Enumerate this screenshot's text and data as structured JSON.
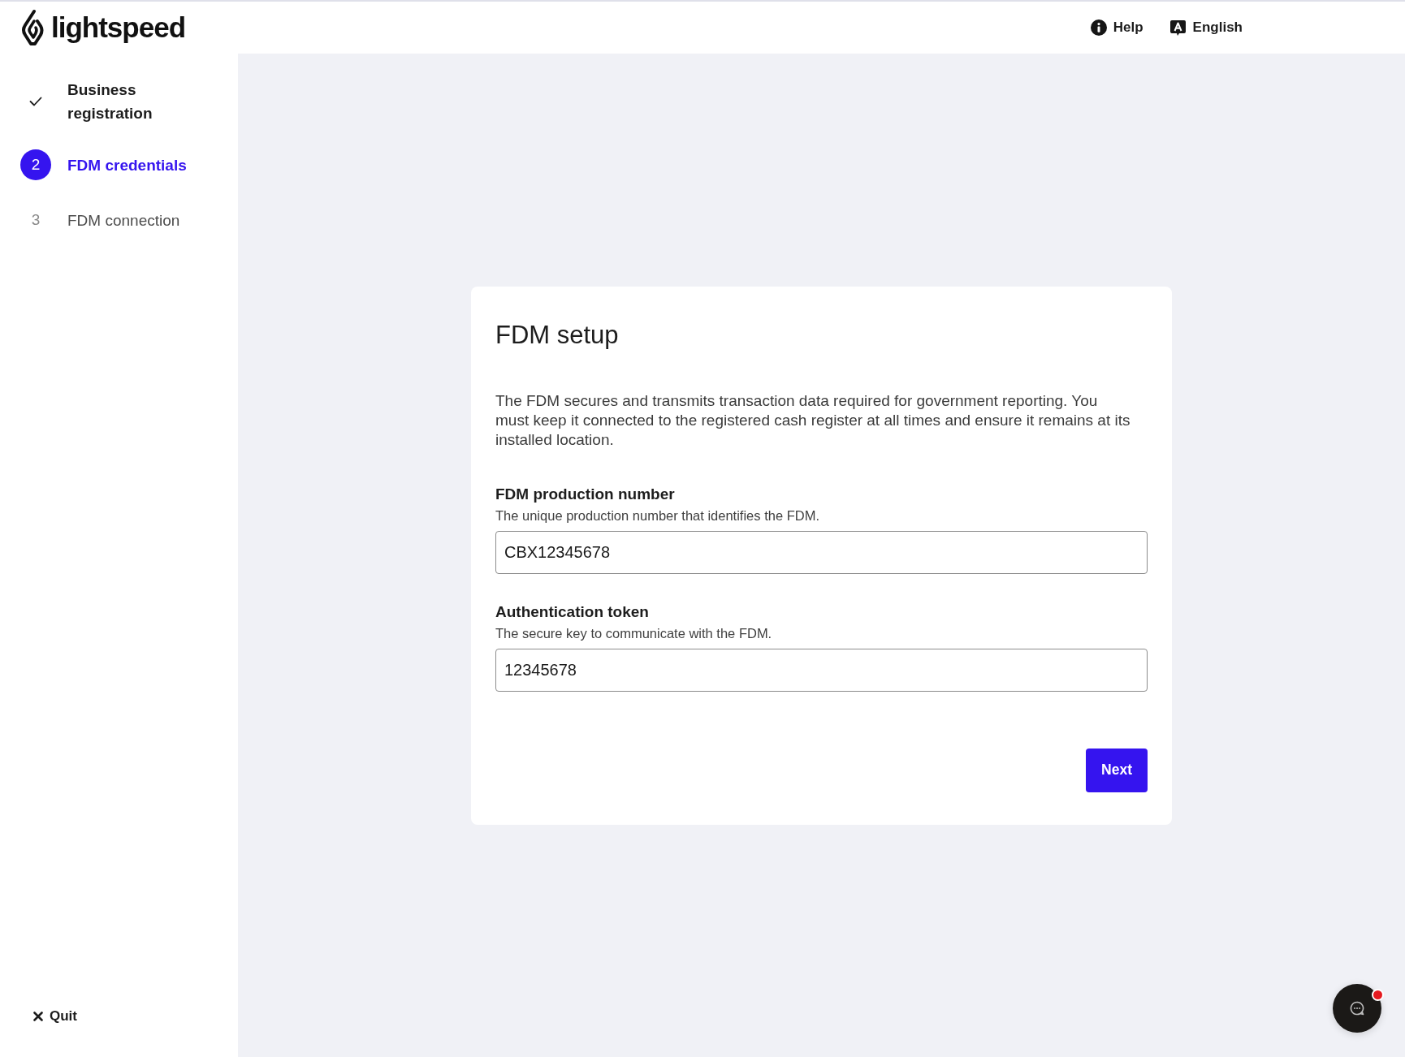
{
  "header": {
    "logo": "lightspeed",
    "links": [
      {
        "kind": "help",
        "label": "Help"
      },
      {
        "kind": "language",
        "label": "English"
      }
    ]
  },
  "sidebar": {
    "steps": [
      {
        "completed": true,
        "selected": false,
        "label": "Business registration"
      },
      {
        "completed": false,
        "selected": true,
        "number": "2",
        "label": "FDM credentials"
      },
      {
        "completed": false,
        "selected": false,
        "number": "3",
        "label": "FDM connection"
      }
    ],
    "quit": {
      "label": "Quit"
    }
  },
  "card": {
    "title": "FDM setup",
    "description": "The FDM secures and transmits transaction data required for government reporting. You must keep it connected to the registered cash register at all times and ensure it remains at its installed location.",
    "fields": [
      {
        "label": "FDM production number",
        "hint": "The unique production number that identifies the FDM.",
        "value": "CBX12345678"
      },
      {
        "label": "Authentication token",
        "hint": "The secure key to communicate with the FDM.",
        "value": "12345678"
      }
    ],
    "button": {
      "label": "Next"
    }
  },
  "chat_button": {
    "unread": true
  }
}
